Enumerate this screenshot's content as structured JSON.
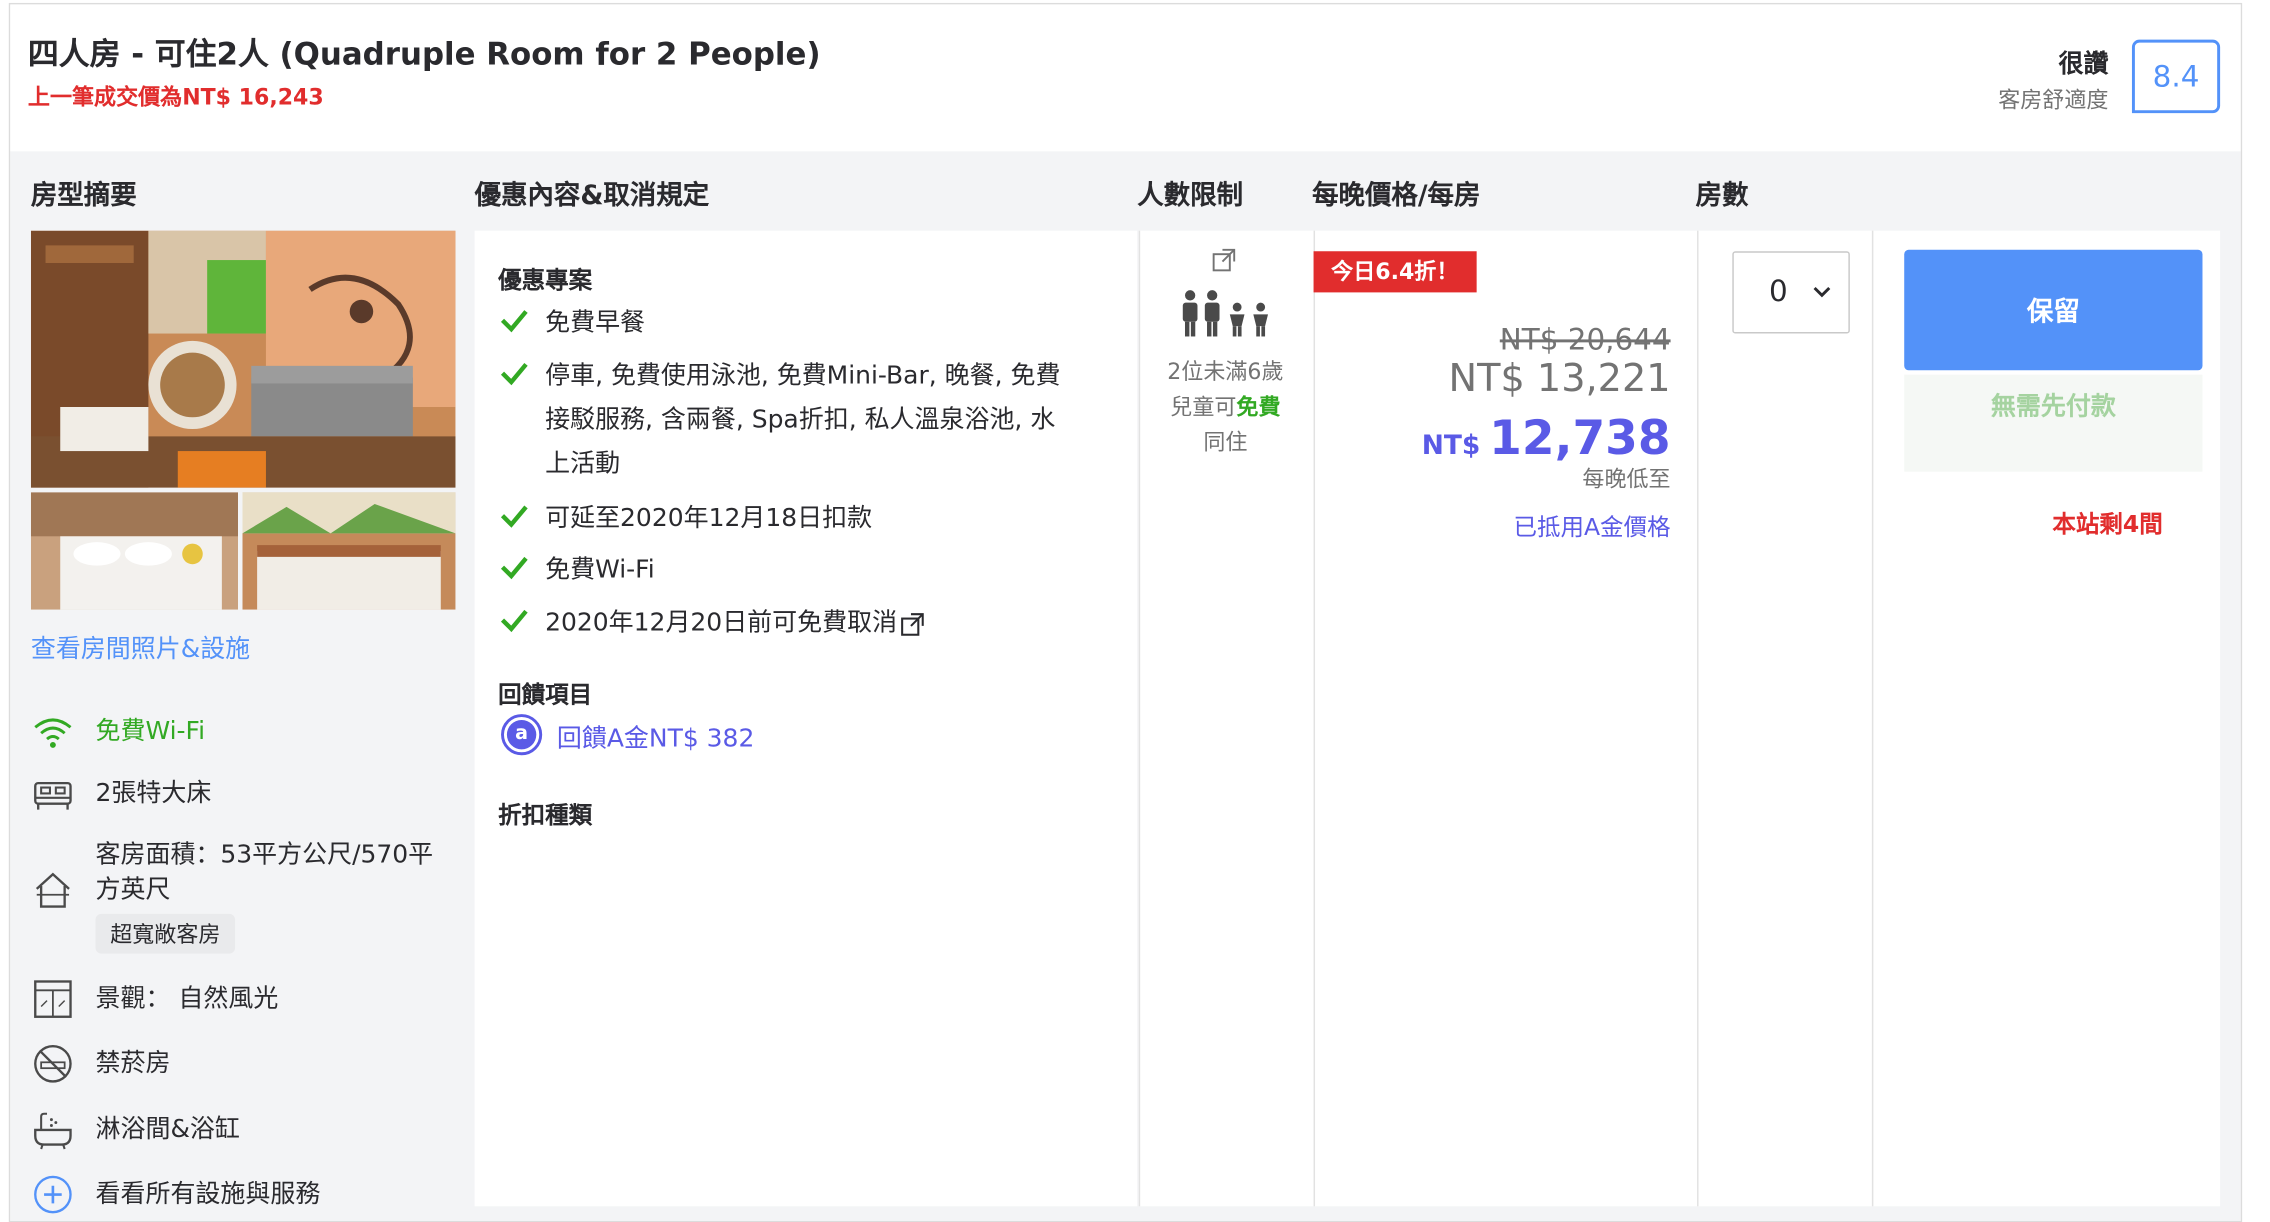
{
  "header": {
    "room_title": "四人房 - 可住2人 (Quadruple Room for 2 People)",
    "last_price": "上一筆成交價為NT$ 16,243",
    "score_word": "很讚",
    "score_sub": "客房舒適度",
    "score": "8.4"
  },
  "columns": {
    "room_summary": "房型摘要",
    "offers": "優惠內容&取消規定",
    "occupancy": "人數限制",
    "price": "每晚價格/每房",
    "rooms": "房數"
  },
  "room": {
    "photos_link": "查看房間照片&設施",
    "amenities": [
      {
        "icon": "wifi-icon",
        "label": "免費Wi-Fi"
      },
      {
        "icon": "bed-icon",
        "label": "2張特大床"
      },
      {
        "icon": "house-icon",
        "label": "客房面積：53平方公尺/570平方英尺",
        "tag": "超寬敞客房"
      },
      {
        "icon": "window-view-icon",
        "label": "景觀： 自然風光"
      },
      {
        "icon": "no-smoking-icon",
        "label": "禁菸房"
      },
      {
        "icon": "bathtub-icon",
        "label": "淋浴間&浴缸"
      }
    ],
    "all_facilities_link": "看看所有設施與服務"
  },
  "offers": {
    "deal_heading": "優惠專案",
    "benefits": [
      "免費早餐",
      "停車, 免費使用泳池, 免費Mini-Bar, 晚餐, 免費接駁服務, 含兩餐, Spa折扣, 私人溫泉浴池, 水上活動",
      "可延至2020年12月18日扣款",
      "免費Wi-Fi",
      "2020年12月20日前可免費取消"
    ],
    "cashback_heading": "回饋項目",
    "cashback_coin": "a",
    "cashback": "回饋A金NT$ 382",
    "discount_heading": "折扣種類"
  },
  "occupancy": {
    "adults": 2,
    "children": 2,
    "note_line1": "2位未滿6歲",
    "note_line2a": "兒童可",
    "note_line2b": "免費",
    "note_line3": "同住"
  },
  "price": {
    "deal_badge": "今日6.4折！",
    "original_strike": "NT$ 20,644",
    "original": "NT$ 13,221",
    "currency": "NT$",
    "final": "12,738",
    "per_night": "每晚低至",
    "applied": "已抵用A金價格"
  },
  "rooms_select": {
    "value": "0"
  },
  "book": {
    "reserve_label": "保留",
    "no_prepay": "無需先付款",
    "remaining": "本站剩4間"
  },
  "colors": {
    "accent_blue": "#5392f9",
    "price_purple": "#5a5ae6",
    "alert_red": "#e12d2d",
    "green": "#32a923"
  }
}
